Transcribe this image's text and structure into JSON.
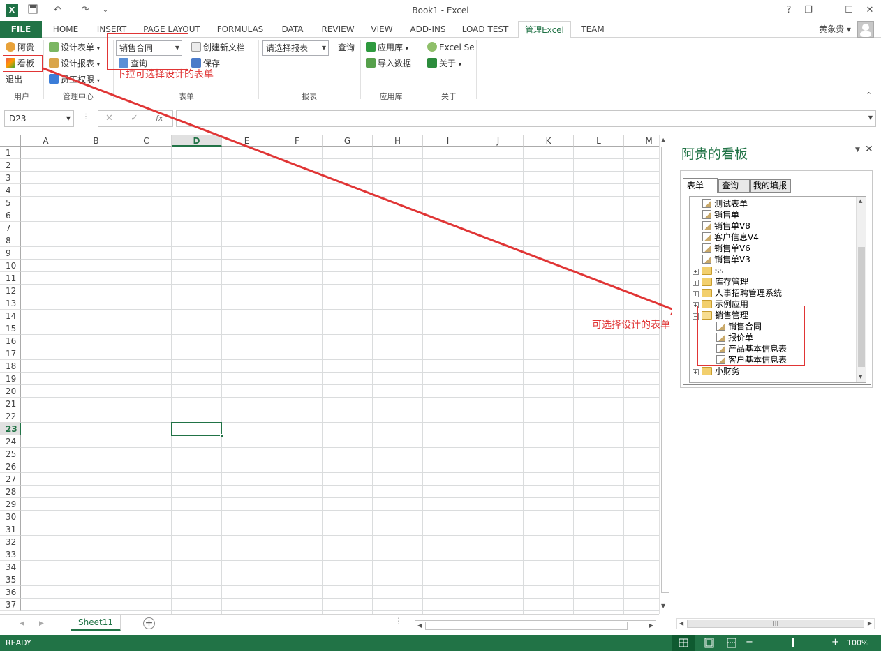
{
  "window": {
    "title": "Book1 - Excel",
    "controls": [
      "?",
      "❐",
      "—",
      "☐",
      "✕"
    ]
  },
  "qat": {
    "undo": "↶",
    "redo": "↷",
    "more": "⌄"
  },
  "tabs": [
    {
      "label": "FILE"
    },
    {
      "label": "HOME"
    },
    {
      "label": "INSERT"
    },
    {
      "label": "PAGE LAYOUT"
    },
    {
      "label": "FORMULAS"
    },
    {
      "label": "DATA"
    },
    {
      "label": "REVIEW"
    },
    {
      "label": "VIEW"
    },
    {
      "label": "ADD-INS"
    },
    {
      "label": "LOAD TEST"
    },
    {
      "label": "管理Excel"
    },
    {
      "label": "TEAM"
    }
  ],
  "user": {
    "name": "黄象贵 ▾"
  },
  "ribbon": {
    "user_group": {
      "label": "用户",
      "items": [
        "阿贵",
        "看板",
        "退出"
      ]
    },
    "mgmt_group": {
      "label": "管理中心",
      "items": [
        "设计表单",
        "设计报表",
        "员工权限"
      ]
    },
    "form_group": {
      "label": "表单",
      "combo_value": "销售合同",
      "items": [
        "创建新文档",
        "查询",
        "保存"
      ]
    },
    "report_group": {
      "label": "报表",
      "combo_value": "请选择报表",
      "query": "查询"
    },
    "app_group": {
      "label": "应用库",
      "items": [
        "应用库",
        "导入数据"
      ]
    },
    "about_group": {
      "label": "关于",
      "items": [
        "Excel Se",
        "关于"
      ]
    }
  },
  "annotations": {
    "dropdown_note": "下拉可选择设计的表单",
    "panel_note": "可选择设计的表单"
  },
  "formula_bar": {
    "name_box": "D23",
    "fx": "fx",
    "cancel": "✕",
    "enter": "✓",
    "value": ""
  },
  "grid": {
    "columns": [
      "A",
      "B",
      "C",
      "D",
      "E",
      "F",
      "G",
      "H",
      "I",
      "J",
      "K",
      "L",
      "M"
    ],
    "rows": [
      "1",
      "2",
      "3",
      "4",
      "5",
      "6",
      "7",
      "8",
      "9",
      "10",
      "11",
      "12",
      "13",
      "14",
      "15",
      "16",
      "17",
      "18",
      "19",
      "20",
      "21",
      "22",
      "23",
      "24",
      "25",
      "26",
      "27",
      "28",
      "29",
      "30",
      "31",
      "32",
      "33",
      "34",
      "35",
      "36",
      "37"
    ],
    "active_cell": "D23"
  },
  "sheets": [
    {
      "label": "Sheet11"
    }
  ],
  "panel": {
    "title": "阿贵的看板",
    "tabs": [
      "表单",
      "查询",
      "我的填报"
    ],
    "tree": [
      {
        "label": "测试表单",
        "kind": "doc"
      },
      {
        "label": "销售单",
        "kind": "doc"
      },
      {
        "label": "销售单V8",
        "kind": "doc"
      },
      {
        "label": "客户信息V4",
        "kind": "doc"
      },
      {
        "label": "销售单V6",
        "kind": "doc"
      },
      {
        "label": "销售单V3",
        "kind": "doc"
      },
      {
        "label": "ss",
        "kind": "folder"
      },
      {
        "label": "库存管理",
        "kind": "folder"
      },
      {
        "label": "人事招聘管理系统",
        "kind": "folder"
      },
      {
        "label": "示例应用",
        "kind": "folder"
      },
      {
        "label": "销售管理",
        "kind": "folder-open"
      },
      {
        "label": "销售合同",
        "kind": "child"
      },
      {
        "label": "报价单",
        "kind": "child"
      },
      {
        "label": "产品基本信息表",
        "kind": "child"
      },
      {
        "label": "客户基本信息表",
        "kind": "child"
      },
      {
        "label": "小财务",
        "kind": "folder"
      }
    ]
  },
  "status": {
    "text": "READY",
    "zoom": "100%"
  }
}
